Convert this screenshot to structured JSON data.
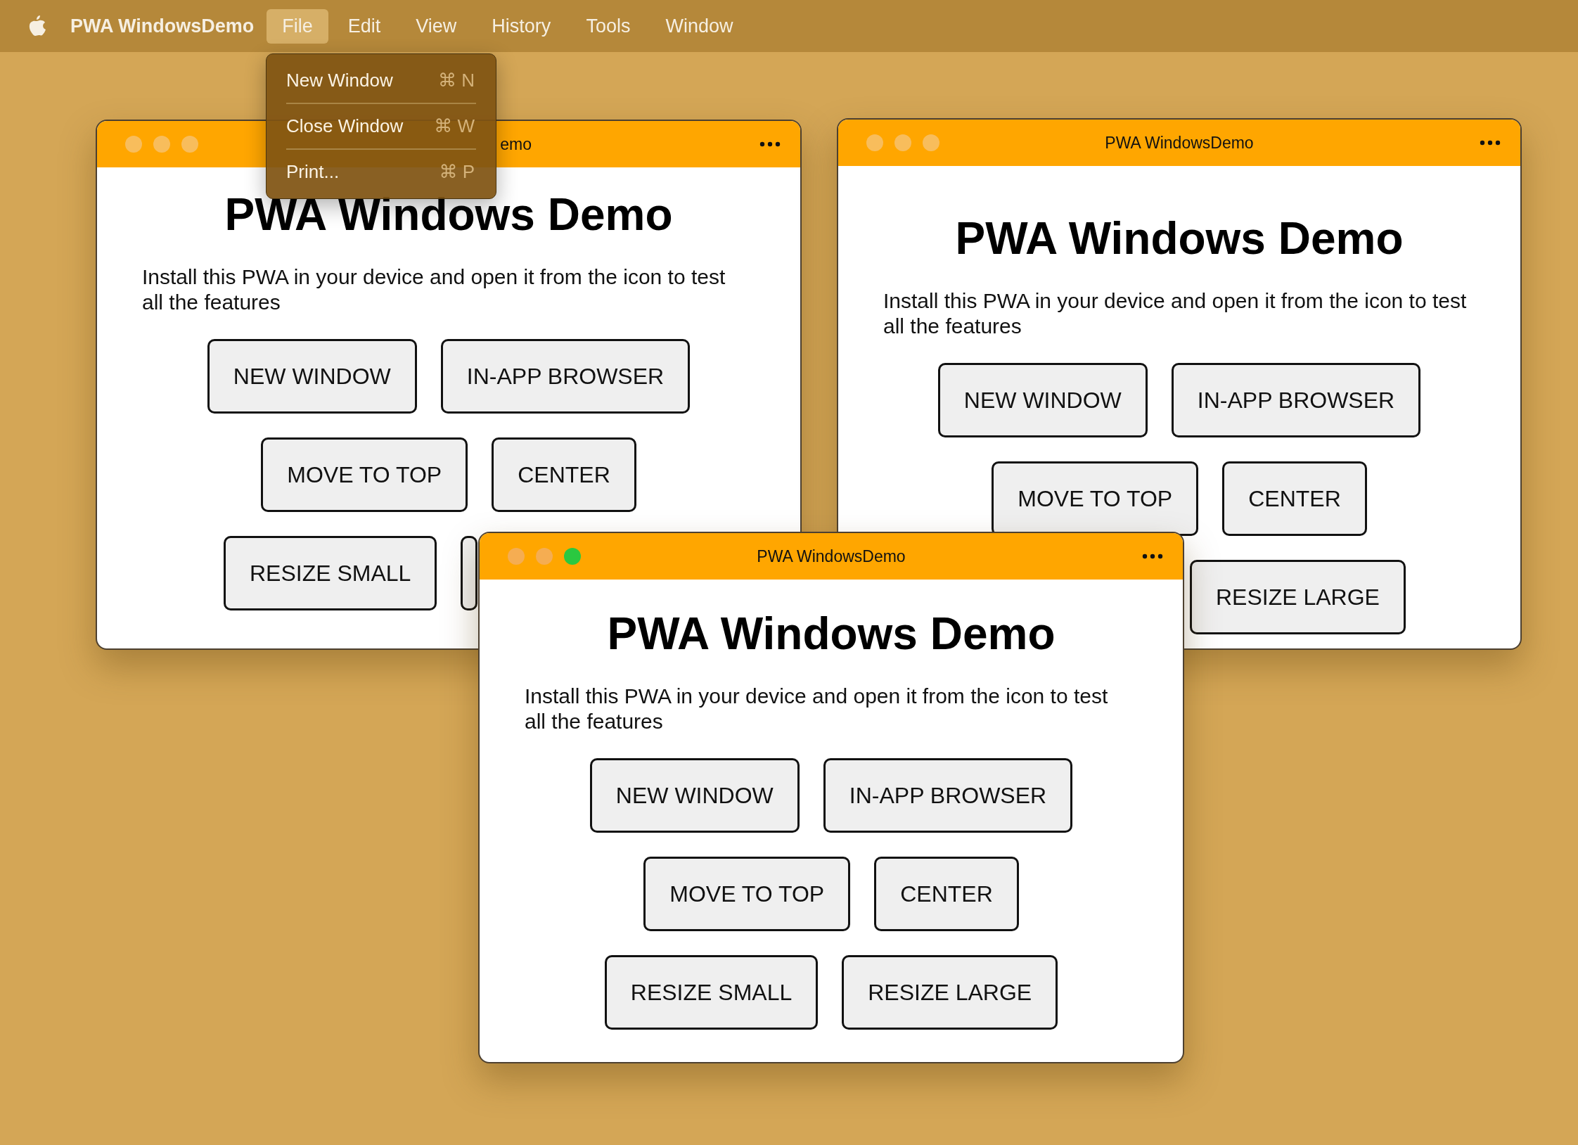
{
  "menu_bar": {
    "app_name": "PWA WindowsDemo",
    "items": [
      {
        "label": "File",
        "selected": true
      },
      {
        "label": "Edit",
        "selected": false
      },
      {
        "label": "View",
        "selected": false
      },
      {
        "label": "History",
        "selected": false
      },
      {
        "label": "Tools",
        "selected": false
      },
      {
        "label": "Window",
        "selected": false
      }
    ]
  },
  "open_menu": {
    "items": [
      {
        "label": "New Window",
        "shortcut": "⌘ N"
      },
      {
        "label": "Close Window",
        "shortcut": "⌘ W"
      },
      {
        "label": "Print...",
        "shortcut": "⌘ P"
      }
    ]
  },
  "windows": [
    {
      "title": "emo",
      "title_cut_at_left": true,
      "dots": [
        {
          "color": "#f8bd5c"
        },
        {
          "color": "#f8bd5c"
        },
        {
          "color": "#f8bd5c"
        }
      ],
      "heading": "PWA Windows Demo",
      "text": "Install this PWA in your device and open it from the icon to test all the features",
      "button_rows": [
        {
          "buttons": [
            {
              "label": "NEW WINDOW"
            },
            {
              "label": "IN-APP BROWSER"
            }
          ]
        },
        {
          "buttons": [
            {
              "label": "MOVE TO TOP"
            },
            {
              "label": "CENTER"
            }
          ]
        },
        {
          "buttons": [
            {
              "label": "RESIZE SMALL"
            },
            {
              "covered": true
            }
          ]
        }
      ]
    },
    {
      "title": "PWA WindowsDemo",
      "title_cut_at_left": false,
      "dots": [
        {
          "color": "#f8bd5c"
        },
        {
          "color": "#f8bd5c"
        },
        {
          "color": "#f8bd5c"
        }
      ],
      "heading": "PWA Windows Demo",
      "text": "Install this PWA in your device and open it from the icon to test all the features",
      "button_rows": [
        {
          "buttons": [
            {
              "label": "NEW WINDOW"
            },
            {
              "label": "IN-APP BROWSER"
            }
          ]
        },
        {
          "buttons": [
            {
              "label": "MOVE TO TOP"
            },
            {
              "label": "CENTER"
            }
          ]
        },
        {
          "buttons": [
            {
              "label": "RESIZE LARGE"
            }
          ]
        }
      ]
    },
    {
      "title": "PWA WindowsDemo",
      "title_cut_at_left": false,
      "dots": [
        {
          "color": "#f5ad52"
        },
        {
          "color": "#f5ad52"
        },
        {
          "color": "#2ac840"
        }
      ],
      "heading": "PWA Windows Demo",
      "text": "Install this PWA in your device and open it from the icon to test all the features",
      "button_rows": [
        {
          "buttons": [
            {
              "label": "NEW WINDOW"
            },
            {
              "label": "IN-APP BROWSER"
            }
          ]
        },
        {
          "buttons": [
            {
              "label": "MOVE TO TOP"
            },
            {
              "label": "CENTER"
            }
          ]
        },
        {
          "buttons": [
            {
              "label": "RESIZE SMALL"
            },
            {
              "label": "RESIZE LARGE"
            }
          ]
        }
      ]
    }
  ]
}
